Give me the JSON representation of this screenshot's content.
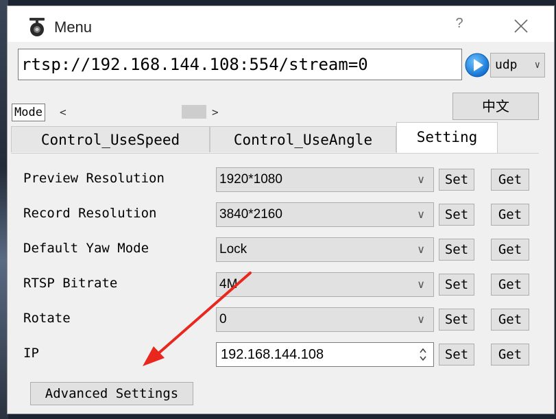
{
  "window": {
    "title": "Menu",
    "help_label": "?",
    "close_glyph": "close-icon"
  },
  "connection": {
    "url": "rtsp://192.168.144.108:554/stream=0",
    "play_icon": "play-icon",
    "protocol": "udp"
  },
  "toolbar": {
    "mode_label": "Mode",
    "scroll_left": "<",
    "scroll_right": ">",
    "language_button": "中文"
  },
  "tabs": [
    {
      "label": "Control_UseSpeed",
      "active": false
    },
    {
      "label": "Control_UseAngle",
      "active": false
    },
    {
      "label": "Setting",
      "active": true
    }
  ],
  "settings": {
    "rows": [
      {
        "label": "Preview Resolution",
        "value": "1920*1080"
      },
      {
        "label": "Record Resolution",
        "value": "3840*2160"
      },
      {
        "label": "Default Yaw Mode",
        "value": "Lock"
      },
      {
        "label": "RTSP Bitrate",
        "value": "4M"
      },
      {
        "label": "Rotate",
        "value": "0"
      }
    ],
    "ip": {
      "label": "IP",
      "value": "192.168.144.108"
    },
    "set_label": "Set",
    "get_label": "Get",
    "advanced_button": "Advanced Settings"
  },
  "annotation": {
    "arrow_color": "#e8271f"
  },
  "colors": {
    "play_blue": "#1e8fe6"
  }
}
